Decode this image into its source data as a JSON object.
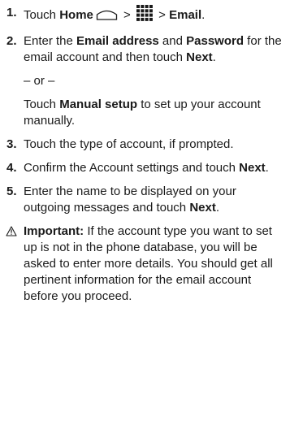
{
  "steps": [
    {
      "num": "1.",
      "t1": "Touch ",
      "b1": "Home",
      "t2": " > ",
      "t3": " > ",
      "b2": "Email",
      "t4": "."
    },
    {
      "num": "2.",
      "t1": "Enter the ",
      "b1": "Email address",
      "t2": " and ",
      "b2": "Password",
      "t3": " for the email account and then touch ",
      "b3": "Next",
      "t4": ".",
      "or": "– or –",
      "alt_t1": "Touch ",
      "alt_b1": "Manual setup",
      "alt_t2": " to set up your account manually."
    },
    {
      "num": "3.",
      "t1": "Touch the type of account, if prompted."
    },
    {
      "num": "4.",
      "t1": "Confirm the Account settings and touch ",
      "b1": "Next",
      "t2": "."
    },
    {
      "num": "5.",
      "t1": "Enter the name to be displayed on your outgoing messages and touch ",
      "b1": "Next",
      "t2": "."
    }
  ],
  "note": {
    "label": "Important:",
    "text": " If the account type you want to set up is not in the phone database, you will be asked to enter more details. You should get all pertinent information for the email account before you proceed."
  }
}
